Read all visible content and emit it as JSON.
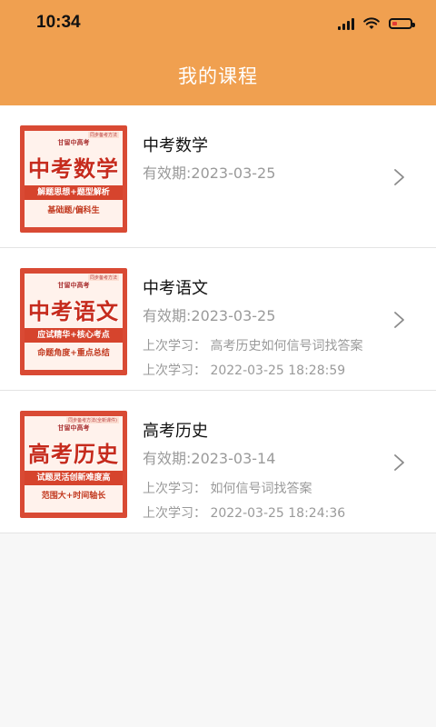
{
  "status_bar": {
    "time": "10:34"
  },
  "header": {
    "title": "我的课程"
  },
  "courses": [
    {
      "name": "中考数学",
      "validity": "有效期:2023-03-25",
      "cover": {
        "brand": "甘留中高考",
        "tag": "同步备考方法",
        "title": "中考数学",
        "band": "解题思想+题型解析",
        "sub": "基础题/偏科生"
      }
    },
    {
      "name": "中考语文",
      "validity": "有效期:2023-03-25",
      "last_course": "上次学习： 高考历史如何信号词找答案",
      "last_time": "上次学习： 2022-03-25 18:28:59",
      "cover": {
        "brand": "甘留中高考",
        "tag": "同步备考方法",
        "title": "中考语文",
        "band": "应试精华+核心考点",
        "sub": "命题角度+重点总结"
      }
    },
    {
      "name": "高考历史",
      "validity": "有效期:2023-03-14",
      "last_course": "上次学习： 如何信号词找答案",
      "last_time": "上次学习： 2022-03-25 18:24:36",
      "cover": {
        "brand": "甘留中高考",
        "tag": "同步备考方法(全新课件)",
        "title": "高考历史",
        "band": "试题灵活创新难度高",
        "sub": "范围大+时间轴长"
      }
    }
  ],
  "colors": {
    "header": "#f0a050",
    "cover": "#d94a34",
    "muted_text": "#9a9a9a"
  }
}
